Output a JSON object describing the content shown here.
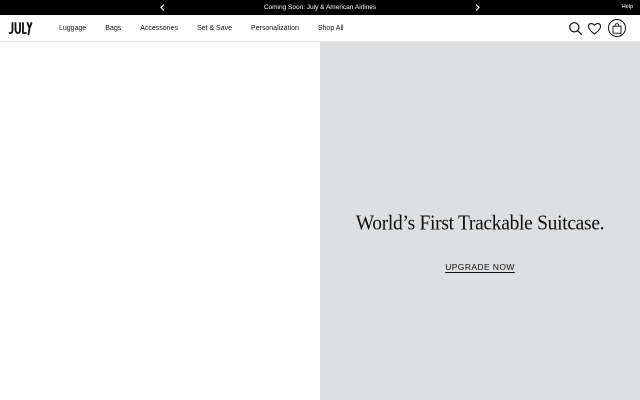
{
  "announcement": {
    "text": "Coming Soon: July & American Airlines",
    "help_label": "Help",
    "background": "#000000",
    "text_color": "#ffffff"
  },
  "header": {
    "logo_text": "JULY",
    "menu": [
      {
        "label": "Luggage"
      },
      {
        "label": "Bags"
      },
      {
        "label": "Accessories"
      },
      {
        "label": "Set & Save"
      },
      {
        "label": "Personalization"
      },
      {
        "label": "Shop All"
      }
    ],
    "icons": [
      "search-icon",
      "heart-icon",
      "shopping-bag-icon"
    ]
  },
  "hero": {
    "title": "World’s First Trackable Suitcase.",
    "cta_label": "UPGRADE NOW",
    "panel_color": "#dedfe0"
  }
}
